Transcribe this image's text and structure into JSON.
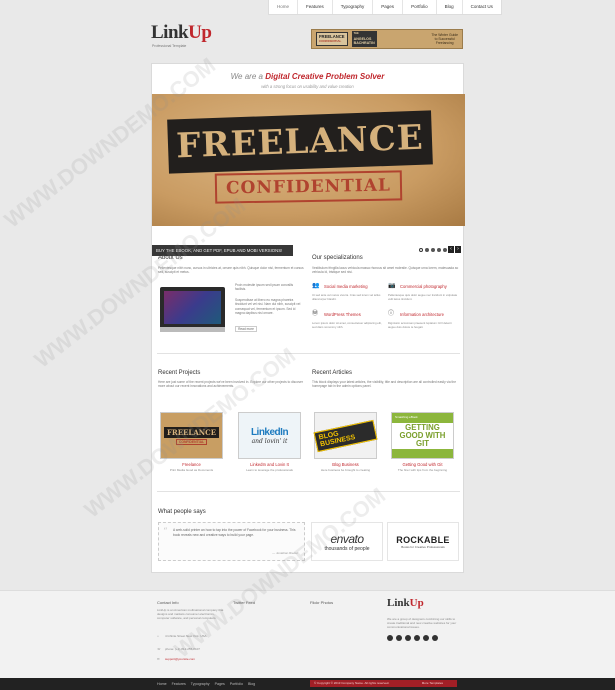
{
  "nav": {
    "items": [
      "Home",
      "Features",
      "Typography",
      "Pages",
      "Portfolio",
      "Blog",
      "Contact Us"
    ],
    "active": "Home"
  },
  "header": {
    "logo_link": "Link",
    "logo_up": "Up",
    "tagline": "Professional Template",
    "banner": {
      "a": "FREELANCE",
      "a2": "CONFIDENTIAL",
      "b": "THE",
      "b2": "ANGELOS",
      "b3": "BACHRATIN",
      "c": "The Winter Guide",
      "c2": "to Successful",
      "c3": "Freelancing"
    }
  },
  "intro": {
    "prefix": "We are a ",
    "highlight": "Digital Creative Problem Solver",
    "sub": "with a strong focus on usability and value creation"
  },
  "slider": {
    "title1": "FREELANCE",
    "title2": "CONFIDENTIAL",
    "caption": "BUY THE EBOOK, AND GET PDF, EPUB AND MOBI VERSIONS!",
    "prev": "‹",
    "next": "›"
  },
  "about": {
    "title": "About Us",
    "text": "Pellentesque nibh nunc, cursus in ultricies at, ornare quis nibh. Quisque dolor nisl, fermentum et cursus sed, suscipit et metus.",
    "side1": "Proin molestie ipsum sed ipsum convallis facilisis.",
    "side2": "Suspendisse at libero eu magna pharetra tincidunt vel vel nisi. Nam dui nibh, suscipit vel consequat vel, fermentum et ipsum. Sed id magna dapibus nisl ornare.",
    "read_more": "Read more"
  },
  "specializations": {
    "title": "Our specializations",
    "text": "Vestibulum fringilla lacus vehicula massa rhoncus sit amet molestie. Quisque urna lorem, malesuada ac vehicula id, tristique sed nisi.",
    "items": [
      {
        "icon": "users-icon",
        "label": "Social media marketing",
        "desc": "Ut sed ante vel metus viverra. Cras sed lorem vel tellus ullamcorper blandit."
      },
      {
        "icon": "camera-icon",
        "label": "Commercial photography",
        "desc": "Pellentesque quis dolor augue nec tincidunt in vulputate velit lacus tincidunt."
      },
      {
        "icon": "wordpress-icon",
        "label": "WordPress Themes",
        "desc": "Lorem ipsum dolor sit amet, consectetuer adipiscing elit, sed diam nonummy nibh."
      },
      {
        "icon": "info-icon",
        "label": "Information architecture",
        "desc": "Dignissim accumsan praesent luptatum zzril delenit augue duis dolore te feugait."
      }
    ]
  },
  "projects": {
    "title": "Recent Projects",
    "text": "Here are just some of the recent projects we've been involved in. Explore our other projects to discover more about our recent innovations and achievements.",
    "items": [
      {
        "caption": "Freelance",
        "sub": "Print Media Good as Documents"
      },
      {
        "caption": "LinkedIn and Lovin It",
        "sub": "Learn to leverage the professionals"
      },
      {
        "caption": "Blog Business",
        "sub": "Here business be brought to creating"
      }
    ]
  },
  "articles": {
    "title": "Recent Articles",
    "text": "This block displays your latest articles, the visibility, title and description are all controlled easily via the homepage tab in the admin options panel.",
    "items": [
      {
        "caption": "Getting Good with Git",
        "sub": "The finer with tips from the beginning"
      }
    ]
  },
  "thumbs": {
    "t1a": "FREELANCE",
    "t1b": "CONFIDENTIAL",
    "t2a": "LinkedIn",
    "t2b": "and lovin' it",
    "t3a": "BLOG BUSINESS",
    "t4hd": "Smashing eBook",
    "t4a": "GETTING GOOD WITH GIT"
  },
  "testimonials": {
    "title": "What people says",
    "quote": "A web-solid printer an how to tap into the power of Facebook for your business. This book reveals new and creative ways to build your page.",
    "author": "— Jonathan Rieder",
    "clients": [
      {
        "name": "envato",
        "tag": "thousands of people"
      },
      {
        "name": "ROCKABLE",
        "tag": "Books for Creative Professionals"
      }
    ]
  },
  "footer": {
    "col1_title": "Contact Info",
    "col1_text": "LinkUp is an American multinational company that designs and markets consumer electronics, computer software, and personal computers.",
    "address": "4 Infinite Street New York, USA",
    "phone": "phone: (+1) 812-255-8107",
    "email": "support@yoursite.com",
    "col2_title": "Twitter Feed",
    "col3_title": "Flickr Photos",
    "logo_link": "Link",
    "logo_up": "Up",
    "about": "We are a group of designers combining our skills to create traditional and new creative websites for your communicational issues."
  },
  "bottom": {
    "nav": [
      "Home",
      "Features",
      "Typography",
      "Pages",
      "Portfolio",
      "Blog"
    ],
    "copy": "© Copyright © 2013 Company Name. All rights reserved.",
    "right": "More Templates"
  },
  "watermark": "WWW.DOWNDEMO.COM"
}
